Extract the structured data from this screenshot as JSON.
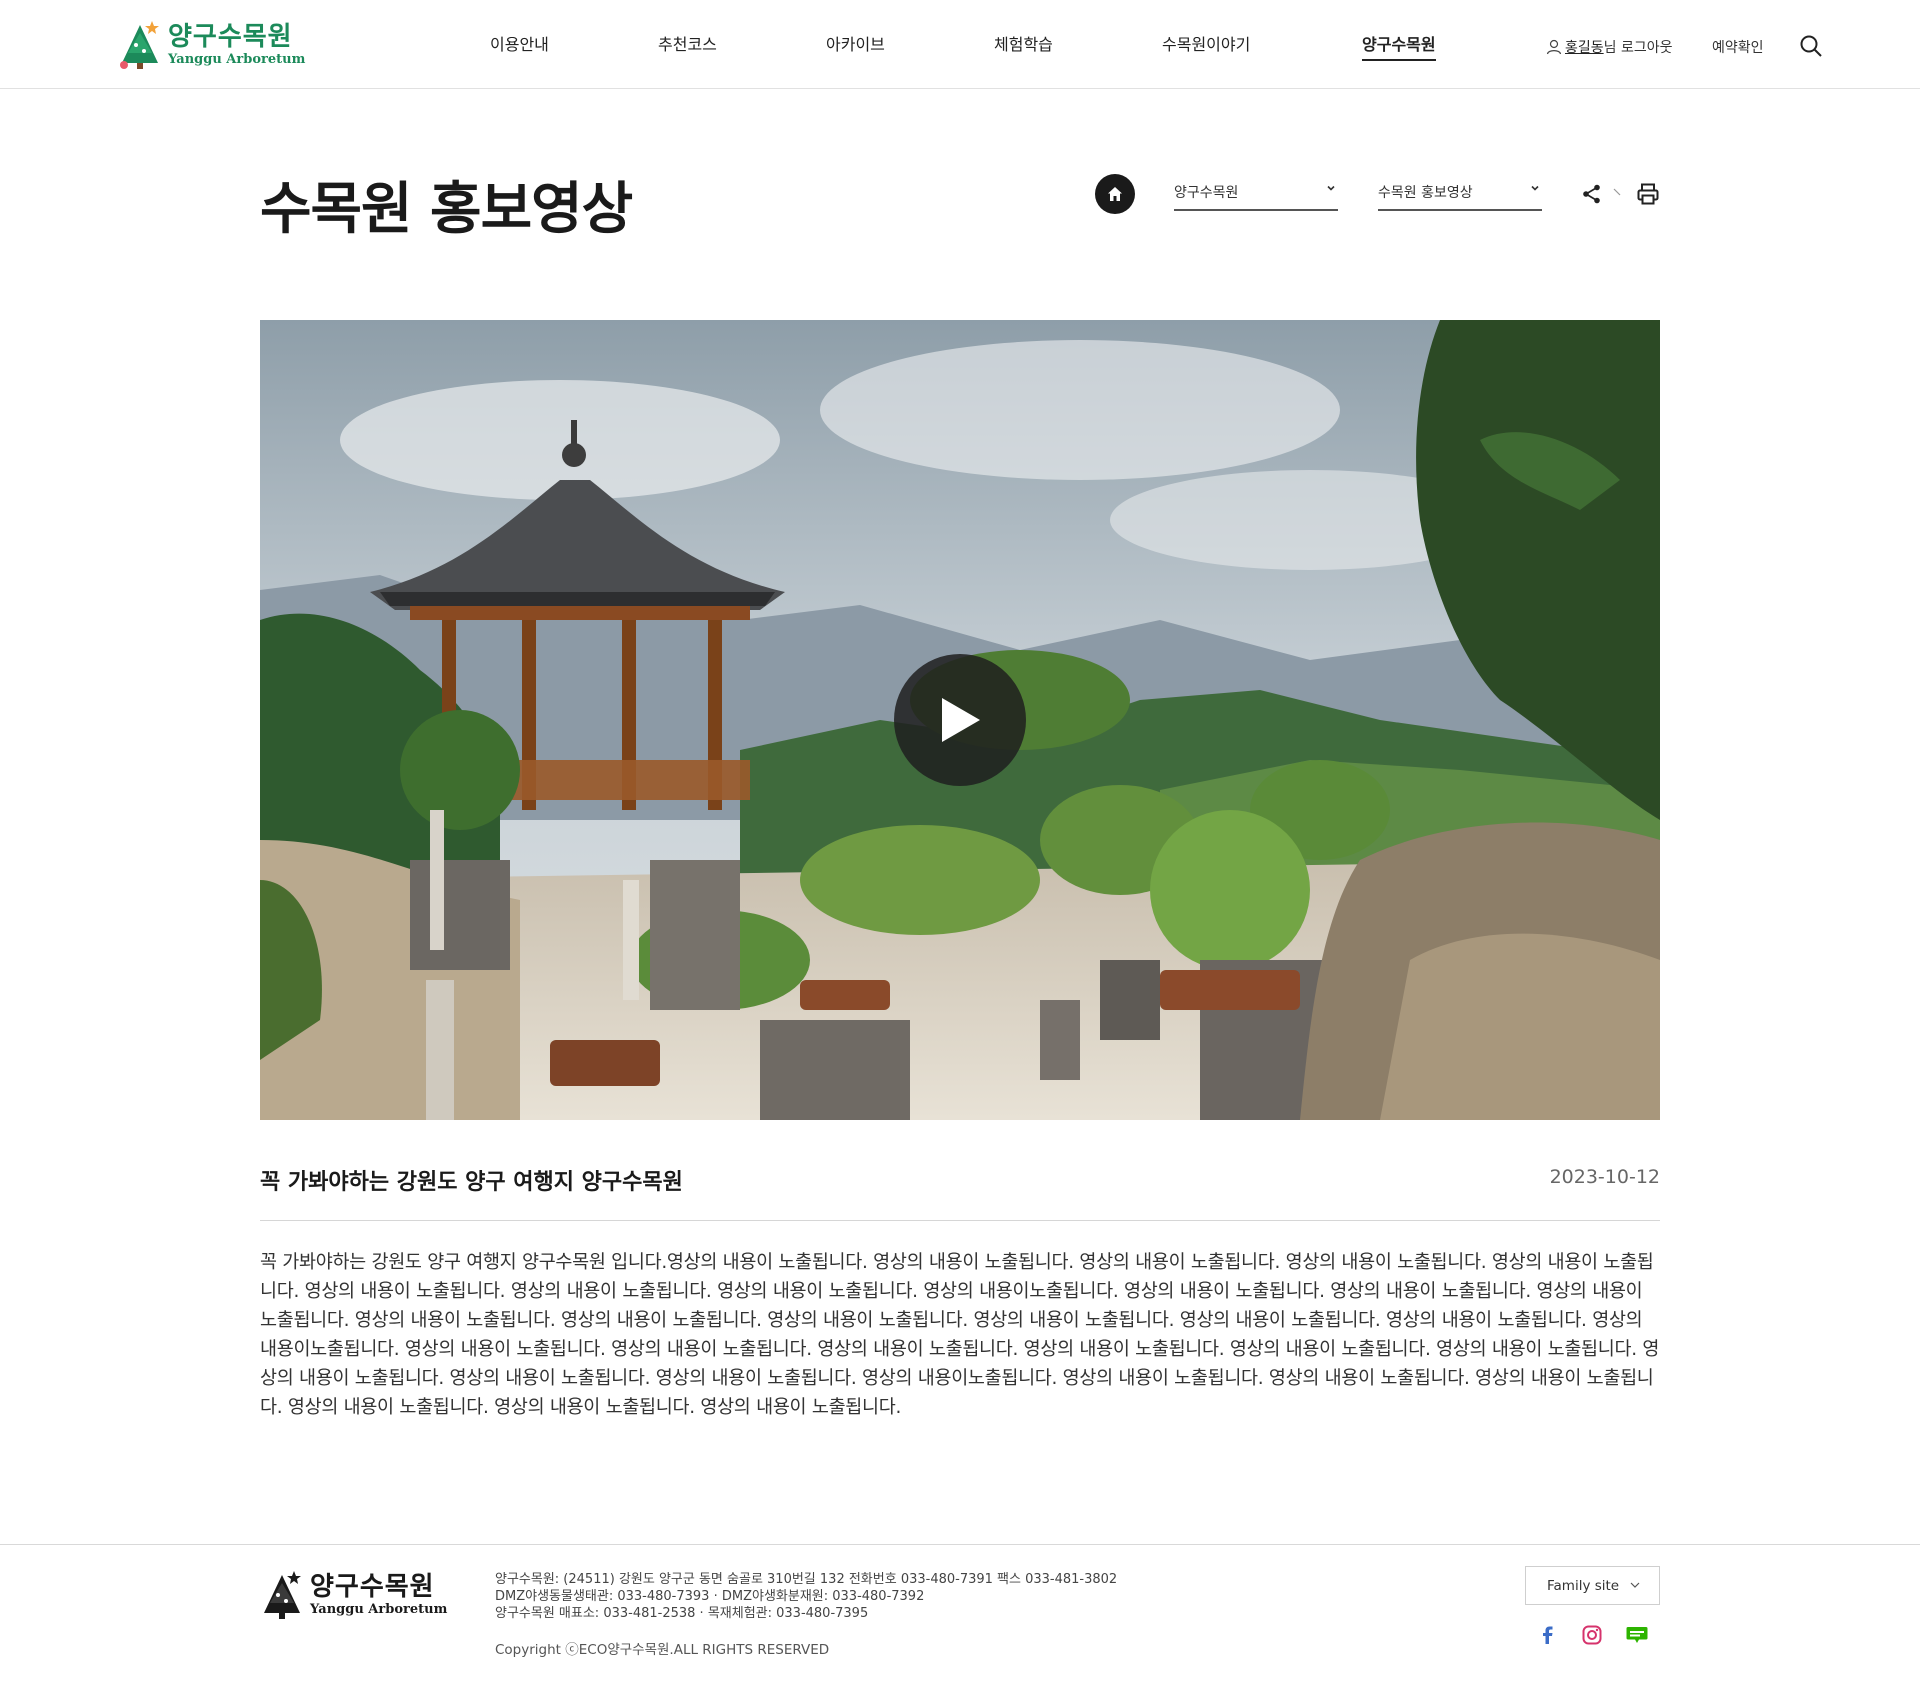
{
  "header": {
    "logo_ko": "양구수목원",
    "logo_en": "Yanggu Arboretum",
    "nav": [
      {
        "label": "이용안내"
      },
      {
        "label": "추천코스"
      },
      {
        "label": "아카이브"
      },
      {
        "label": "체험학습"
      },
      {
        "label": "수목원이야기"
      },
      {
        "label": "양구수목원",
        "active": true
      }
    ],
    "user_name": "홍길동",
    "user_suffix": "님 로그아웃",
    "reservation_label": "예약확인",
    "search_icon": "search-icon"
  },
  "page": {
    "title": "수목원 홍보영상",
    "breadcrumb_select_1": "양구수목원",
    "breadcrumb_select_2": "수목원 홍보영상",
    "icons": [
      "home-icon",
      "share-icon",
      "print-icon"
    ]
  },
  "video": {
    "thumbnail_icon": "play-icon"
  },
  "post": {
    "title": "꼭 가봐야하는 강원도 양구 여행지 양구수목원",
    "date": "2023-10-12",
    "body": "꼭 가봐야하는 강원도 양구 여행지 양구수목원 입니다.영상의 내용이 노출됩니다. 영상의 내용이 노출됩니다. 영상의 내용이 노출됩니다. 영상의 내용이 노출됩니다. 영상의 내용이 노출됩니다. 영상의 내용이 노출됩니다. 영상의 내용이 노출됩니다. 영상의 내용이 노출됩니다. 영상의 내용이노출됩니다. 영상의 내용이 노출됩니다. 영상의 내용이 노출됩니다. 영상의 내용이 노출됩니다. 영상의 내용이 노출됩니다. 영상의 내용이 노출됩니다. 영상의 내용이 노출됩니다. 영상의 내용이 노출됩니다. 영상의 내용이 노출됩니다. 영상의 내용이 노출됩니다. 영상의 내용이노출됩니다. 영상의 내용이 노출됩니다. 영상의 내용이 노출됩니다. 영상의 내용이 노출됩니다. 영상의 내용이 노출됩니다. 영상의 내용이 노출됩니다. 영상의 내용이 노출됩니다. 영상의 내용이 노출됩니다. 영상의 내용이 노출됩니다. 영상의 내용이 노출됩니다. 영상의 내용이노출됩니다. 영상의 내용이 노출됩니다. 영상의 내용이 노출됩니다. 영상의 내용이 노출됩니다. 영상의 내용이 노출됩니다. 영상의 내용이 노출됩니다. 영상의 내용이 노출됩니다."
  },
  "footer": {
    "logo_ko": "양구수목원",
    "logo_en": "Yanggu Arboretum",
    "info_line_1": "양구수목원: (24511) 강원도 양구군 동면 숨골로 310번길 132 전화번호 033-480-7391 팩스 033-481-3802",
    "info_line_2": "DMZ야생동물생태관: 033-480-7393 · DMZ야생화분재원: 033-480-7392",
    "info_line_3": "양구수목원 매표소: 033-481-2538 · 목재체험관: 033-480-7395",
    "copyright": "Copyright ⓒECO양구수목원.ALL RIGHTS RESERVED",
    "family_site_label": "Family site",
    "sns": [
      "facebook-icon",
      "instagram-icon",
      "blog-icon"
    ]
  },
  "colors": {
    "brand_green": "#1c8a5a",
    "text_dark": "#1a1a1a",
    "play_button": "#1e1e1e"
  }
}
